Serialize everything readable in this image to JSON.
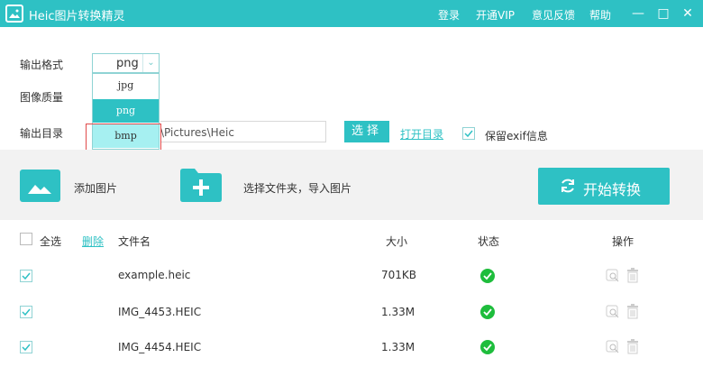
{
  "titlebar": {
    "title": "Heic图片转换精灵",
    "links": {
      "login": "登录",
      "vip": "开通VIP",
      "feedback": "意见反馈",
      "help": "帮助"
    },
    "minimize": "—",
    "maximize": "□",
    "close": "✕"
  },
  "settings": {
    "format_label": "输出格式",
    "quality_label": "图像质量",
    "dir_label": "输出目录",
    "format_value": "png",
    "format_options": [
      "jpg",
      "png",
      "bmp"
    ],
    "dir_value": "\\Pictures\\Heic",
    "choose_button": "选择",
    "open_dir_link": "打开目录",
    "exif_label": "保留exif信息",
    "exif_checked": true
  },
  "actions": {
    "add_image": "添加图片",
    "choose_folder": "选择文件夹，导入图片",
    "start": "开始转换"
  },
  "table": {
    "select_all": "全选",
    "delete": "删除",
    "headers": {
      "name": "文件名",
      "size": "大小",
      "status": "状态",
      "ops": "操作"
    },
    "rows": [
      {
        "name": "example.heic",
        "size": "701KB",
        "status": "ok",
        "checked": true
      },
      {
        "name": "IMG_4453.HEIC",
        "size": "1.33M",
        "status": "ok",
        "checked": true
      },
      {
        "name": "IMG_4454.HEIC",
        "size": "1.33M",
        "status": "ok",
        "checked": true
      }
    ]
  },
  "colors": {
    "accent": "#2ec1c4",
    "success": "#1ebd3c",
    "highlight": "#a6f0f1"
  }
}
